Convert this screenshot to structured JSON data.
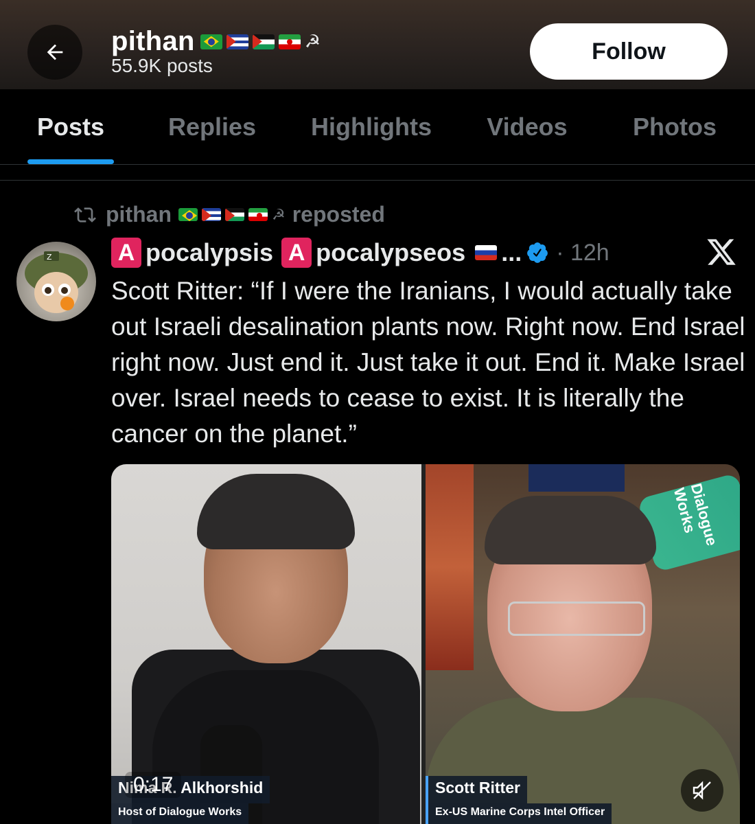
{
  "header": {
    "back_icon": "arrow-left-icon",
    "name": "pithan",
    "name_flags": [
      "brazil-flag",
      "cuba-flag",
      "palestine-flag",
      "iran-flag"
    ],
    "name_symbol": "☭",
    "posts_count": "55.9K posts",
    "follow_label": "Follow"
  },
  "tabs": [
    {
      "label": "Posts",
      "active": true
    },
    {
      "label": "Replies",
      "active": false
    },
    {
      "label": "Highlights",
      "active": false
    },
    {
      "label": "Videos",
      "active": false
    },
    {
      "label": "Photos",
      "active": false
    }
  ],
  "post": {
    "repost_icon": "repost-icon",
    "reposter": "pithan",
    "reposter_symbol": "☭",
    "repost_suffix": "reposted",
    "author_badge": "A",
    "author_part1": "pocalypsis",
    "author_part2": "pocalypseos",
    "author_ellipsis": "...",
    "verified_color": "#1d9bf0",
    "time": "· 12h",
    "platform_icon": "x-logo-icon",
    "text": "Scott Ritter: “If I were the Iranians, I would actually take out Israeli desalination plants now. Right now. End Israel right now. Just end it. Just take it out. End it. Make Israel over. Israel needs to cease to exist. It is literally the cancer on the planet.”"
  },
  "video": {
    "left_name": "Nima R. Alkhorshid",
    "left_title": "Host of Dialogue Works",
    "right_name": "Scott Ritter",
    "right_title": "Ex-US Marine Corps Intel Officer",
    "watermark": "Dialogue Works",
    "timestamp": "0:17",
    "mute_icon": "muted-speaker-icon"
  },
  "colors": {
    "background": "#000000",
    "accent": "#1d9bf0",
    "muted_text": "#71767b",
    "primary_text": "#e7e9ea"
  }
}
